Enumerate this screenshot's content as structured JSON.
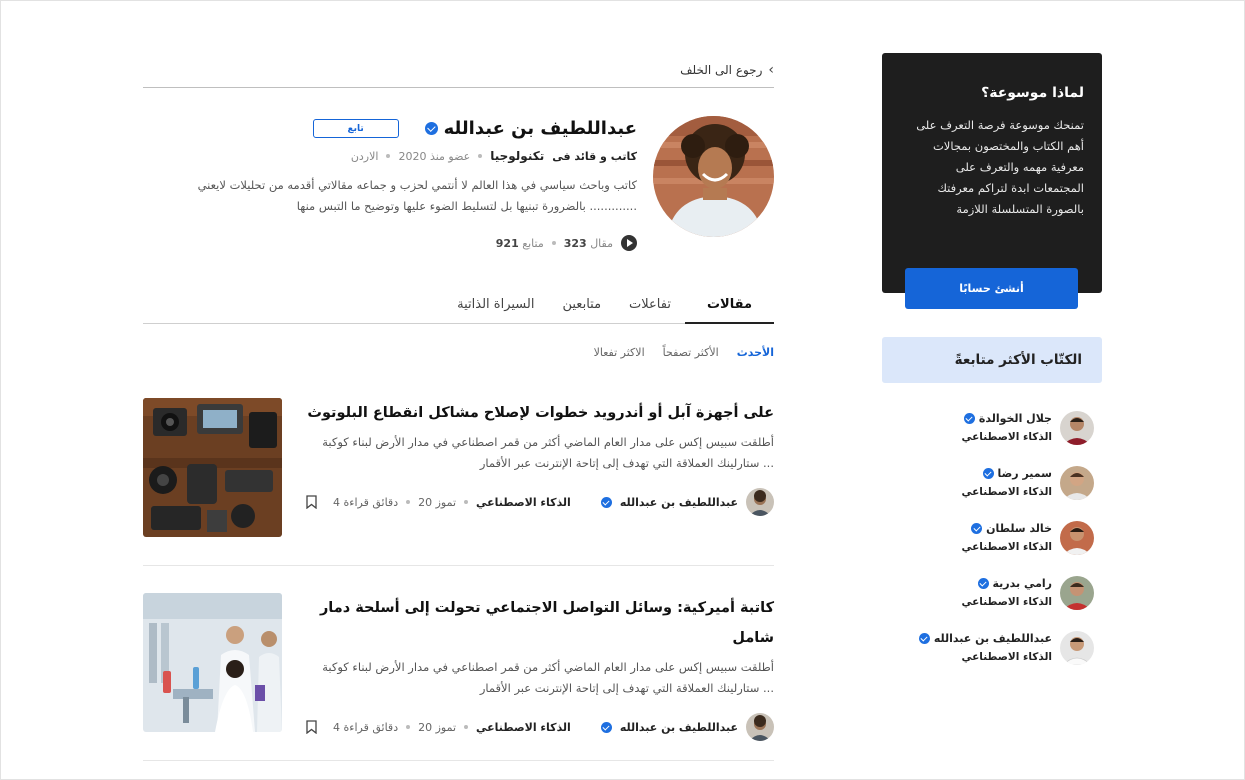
{
  "back": {
    "label": "رجوع الى الخلف"
  },
  "profile": {
    "name": "عبداللطيف بن عبدالله",
    "follow_label": "تابع",
    "role": "كاتب و قائد فى",
    "field": "تكنولوجيا",
    "member_since": "عضو منذ 2020",
    "country": "الاردن",
    "bio": "كاتب وباحث سياسي في هذا العالم لا أنتمي لحزب و جماعه مقالاتي أقدمه من تحليلات لايعني بالضرورة تبنيها بل لتسليط الضوء عليها وتوضيح ما التبس منها .............",
    "articles_count": "323",
    "articles_label": "مقال",
    "followers_count": "921",
    "followers_label": "متابع"
  },
  "tabs": [
    {
      "label": "مقالات",
      "active": true
    },
    {
      "label": "تفاعلات",
      "active": false
    },
    {
      "label": "متابعين",
      "active": false
    },
    {
      "label": "السيراة الذاتية",
      "active": false
    }
  ],
  "filters": [
    {
      "label": "الأحدث",
      "active": true
    },
    {
      "label": "الأكثر تصفحاً",
      "active": false
    },
    {
      "label": "الاكثر تفعالا",
      "active": false
    }
  ],
  "articles": [
    {
      "title": "على أجهزة آبل أو أندرويد خطوات لإصلاح مشاكل انقطاع البلوتوث",
      "excerpt": "أطلقت سبيس إكس على مدار العام الماضي أكثر من قمر اصطناعي في مدار الأرض لبناء كوكبة ستارلينك العملاقة التي تهدف إلى إتاحة الإنترنت عبر الأقمار ...",
      "author": "عبداللطيف بن عبدالله",
      "category": "الذكاء الاصطناعي",
      "date": "20 تموز",
      "read_time": "4 دقائق قراءة"
    },
    {
      "title": "كاتبة أميركية: وسائل التواصل الاجتماعي تحولت إلى أسلحة دمار شامل",
      "excerpt": "أطلقت سبيس إكس على مدار العام الماضي أكثر من قمر اصطناعي في مدار الأرض لبناء كوكبة ستارلينك العملاقة التي تهدف إلى إتاحة الإنترنت عبر الأقمار ...",
      "author": "عبداللطيف بن عبدالله",
      "category": "الذكاء الاصطناعي",
      "date": "20 تموز",
      "read_time": "4 دقائق قراءة"
    }
  ],
  "promo": {
    "title": "لماذا موسوعة؟",
    "text": "تمنحك موسوعة فرصة التعرف على أهم الكتاب والمختصون بمجالات معرفية مهمه والتعرف على المجتمعات ابدة لتراكم معرفتك بالصورة المتسلسلة اللازمة",
    "button_label": "أنشئ حسابًا"
  },
  "top_writers": {
    "title": "الكتّاب الأكثر متابعةً",
    "items": [
      {
        "name": "جلال الخوالدة",
        "category": "الذكاء الاصطناعي"
      },
      {
        "name": "سمير رضا",
        "category": "الذكاء الاصطناعي"
      },
      {
        "name": "خالد سلطان",
        "category": "الذكاء الاصطناعي"
      },
      {
        "name": "رامي بدرية",
        "category": "الذكاء الاصطناعي"
      },
      {
        "name": "عبداللطيف بن عبدالله",
        "category": "الذكاء الاصطناعي"
      }
    ]
  },
  "colors": {
    "accent": "#1565d8",
    "promo_bg": "#1e1e1e",
    "writers_header_bg": "#dbe7fa",
    "verified": "#1e6fe0"
  }
}
